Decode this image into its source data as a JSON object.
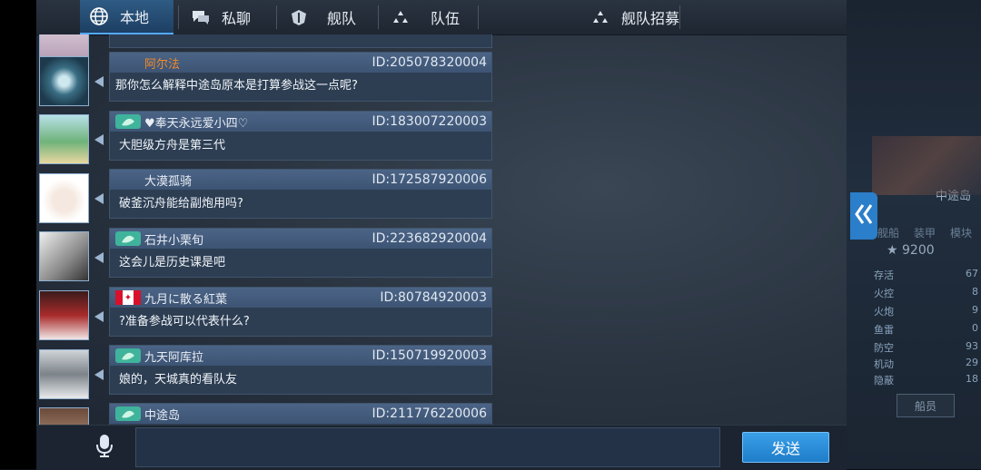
{
  "tabs": [
    {
      "label": "本地",
      "icon": "globe-icon",
      "active": true
    },
    {
      "label": "私聊",
      "icon": "chat-icon",
      "active": false
    },
    {
      "label": "舰队",
      "icon": "fleet-icon",
      "active": false
    },
    {
      "label": "队伍",
      "icon": "team-icon",
      "active": false
    },
    {
      "label": "舰队招募",
      "icon": "recruit-icon",
      "active": false
    }
  ],
  "messages": [
    {
      "name": "阿尔法",
      "id": "ID:205078320004",
      "text": "那你怎么解释中途岛原本是打算参战这一点呢?",
      "badge": "none"
    },
    {
      "name": "♥奉天永远爱小四♡",
      "id": "ID:183007220003",
      "text": "大胆级方舟是第三代",
      "badge": "leaf"
    },
    {
      "name": "大漠孤骑",
      "id": "ID:172587920006",
      "text": "破釜沉舟能给副炮用吗?",
      "badge": "none"
    },
    {
      "name": "石井小栗旬",
      "id": "ID:223682920004",
      "text": "这会儿是历史课是吧",
      "badge": "leaf"
    },
    {
      "name": "九月に散る紅葉",
      "id": "ID:80784920003",
      "text": "?准备参战可以代表什么?",
      "badge": "canada-flag"
    },
    {
      "name": "九天阿库拉",
      "id": "ID:150719920003",
      "text": "娘的，天城真的看队友",
      "badge": "leaf"
    },
    {
      "name": "中途岛",
      "id": "ID:211776220006",
      "text": "",
      "badge": "leaf"
    }
  ],
  "input": {
    "value": "",
    "placeholder": ""
  },
  "send_label": "发送",
  "mic_icon": "microphone-icon",
  "collapse_icon": "double-chevron-left-icon",
  "side": {
    "power": "★ 9200",
    "ship_name": "中途岛",
    "tabs": [
      "舰船",
      "装甲",
      "模块"
    ],
    "stats": [
      {
        "label": "存活",
        "value": "67"
      },
      {
        "label": "火控",
        "value": "8"
      },
      {
        "label": "火炮",
        "value": "9"
      },
      {
        "label": "鱼雷",
        "value": "0"
      },
      {
        "label": "防空",
        "value": "93"
      },
      {
        "label": "机动",
        "value": "29"
      },
      {
        "label": "隐蔽",
        "value": "18"
      }
    ],
    "crew_button": "船员"
  }
}
